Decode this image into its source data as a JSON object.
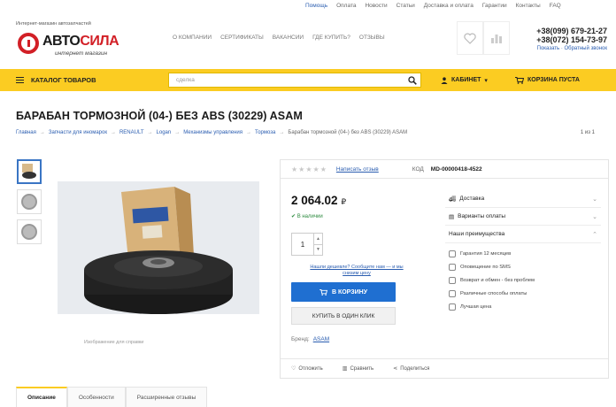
{
  "top_links": [
    "Помощь",
    "Оплата",
    "Новости",
    "Статьи",
    "Доставка и оплата",
    "Гарантии",
    "Контакты",
    "FAQ"
  ],
  "logo": {
    "tagline": "Интернет-магазин автозапчастей",
    "brand_prefix": "АВТО",
    "brand_suffix": "СИЛА",
    "subtitle": "интернет магазин"
  },
  "main_nav": [
    "О КОМПАНИИ",
    "СЕРТИФИКАТЫ",
    "ВАКАНСИИ",
    "ГДЕ КУПИТЬ?",
    "ОТЗЫВЫ"
  ],
  "contacts": {
    "phone1": "+38(099) 679-21-27",
    "phone2": "+38(072) 154-73-97",
    "call_label": "Показать · Обратный звонок"
  },
  "toolbar": {
    "catalog_label": "КАТАЛОГ ТОВАРОВ",
    "search_value": "сделка",
    "cabinet_label": "КАБИНЕТ",
    "cart_label": "КОРЗИНА ПУСТА"
  },
  "product": {
    "title": "БАРАБАН ТОРМОЗНОЙ (04-) БЕЗ ABS (30229) ASAM",
    "breadcrumb": [
      "Главная",
      "Запчасти для иномарок",
      "RENAULT",
      "Logan",
      "Механизмы управления",
      "Тормоза",
      "Барабан тормозной (04-) без ABS (30229) ASAM"
    ],
    "pager": "1 из 1",
    "image_caption": "Изображение для справки",
    "review_link": "Написать отзыв",
    "code_label": "КОД",
    "code_value": "MD-00000418-4522",
    "price": "2 064.02",
    "currency": "₽",
    "stock": "В наличии",
    "quantity": "1",
    "cheaper_label": "Нашли дешевле? Сообщите нам — и мы снизим цену",
    "add_to_cart": "В КОРЗИНУ",
    "one_click": "КУПИТЬ В ОДИН КЛИК",
    "brand_label": "Бренд:",
    "brand_value": "ASAM",
    "bottom_actions": [
      "Отложить",
      "Сравнить",
      "Поделиться"
    ]
  },
  "info_panel": {
    "delivery": "Доставка",
    "payment": "Варианты оплаты",
    "advantages_title": "Наши преимущества",
    "advantages": [
      "Гарантия 12 месяцев",
      "Оповещение по SMS",
      "Возврат и обмен - без проблем",
      "Различные способы оплаты",
      "Лучшая цена"
    ]
  },
  "tabs": [
    "Описание",
    "Особенности",
    "Расширенные отзывы"
  ],
  "colors": {
    "accent_yellow": "#fbcc22",
    "brand_red": "#d21f26",
    "button_blue": "#1f6fd1",
    "link_blue": "#2a5db0"
  }
}
